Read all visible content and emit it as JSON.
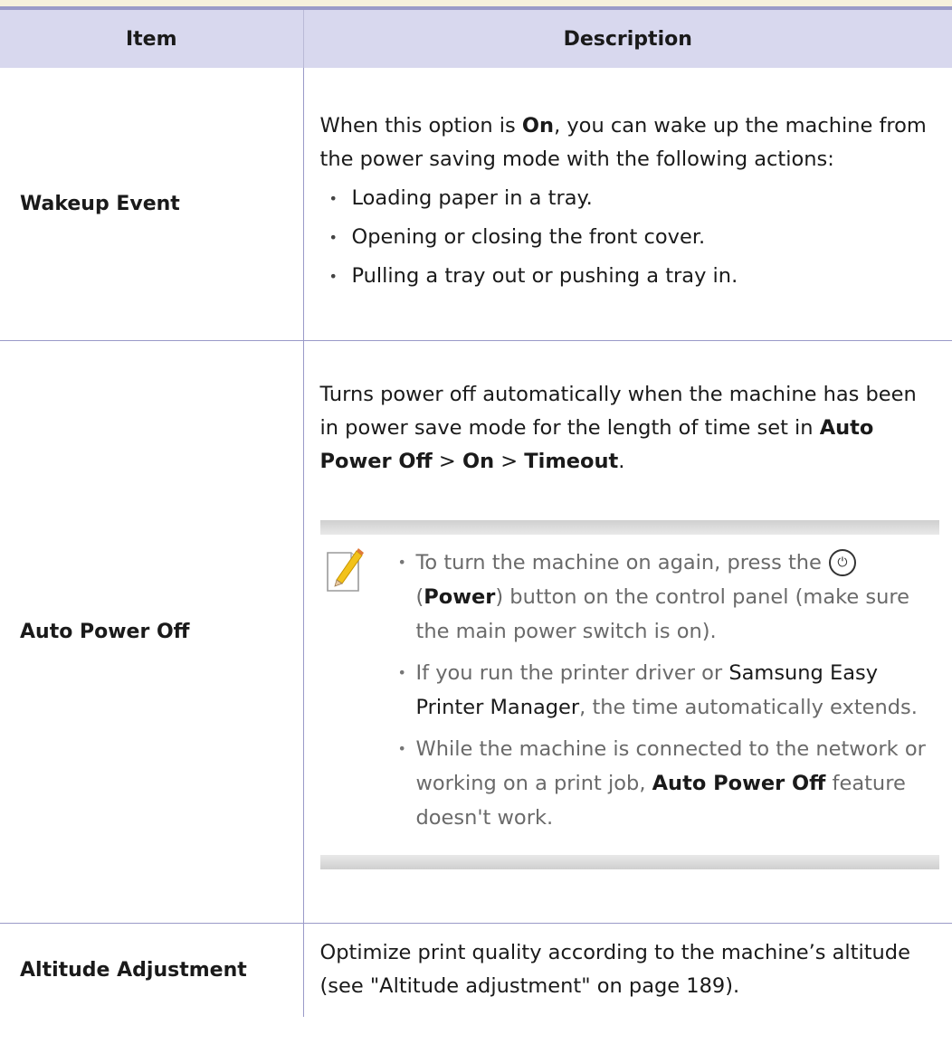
{
  "table": {
    "headers": {
      "item": "Item",
      "description": "Description"
    },
    "rows": {
      "wakeup": {
        "item": "Wakeup Event",
        "intro_1": "When this option is ",
        "intro_bold": "On",
        "intro_2": ", you can wake up the machine from the power saving mode with the following actions:",
        "bullets": [
          "Loading paper in a tray.",
          "Opening or closing the front cover.",
          "Pulling a tray out or pushing a tray in."
        ]
      },
      "auto_power_off": {
        "item": "Auto Power Off",
        "desc_1": "Turns power off automatically when the machine has been in power save mode for the length of time set in ",
        "path_1": "Auto Power Off",
        "sep_1": " > ",
        "path_2": "On",
        "sep_2": " > ",
        "path_3": "Timeout",
        "desc_end": ".",
        "note": {
          "b1_text": "To turn the machine on again, press the",
          "b1_open": "(",
          "b1_bold": "Power",
          "b1_rest": ") button on the control panel (make sure the main power switch is on).",
          "b2_a": "If you run the printer driver or ",
          "b2_dark": "Samsung Easy Printer Manager",
          "b2_b": ", the time automatically extends.",
          "b3_a": "While the machine is connected to the network or working on a print job, ",
          "b3_bold": "Auto Power Off",
          "b3_b": " feature doesn't work."
        }
      },
      "altitude": {
        "item": "Altitude Adjustment",
        "desc": "Optimize print quality according to the machine’s altitude (see \"Altitude adjustment\" on page 189)."
      }
    }
  },
  "icons": {
    "note": "note-pencil-icon",
    "power": "power-icon"
  },
  "colors": {
    "header_bg": "#d8d8ee",
    "rule": "#9a9ac8"
  }
}
